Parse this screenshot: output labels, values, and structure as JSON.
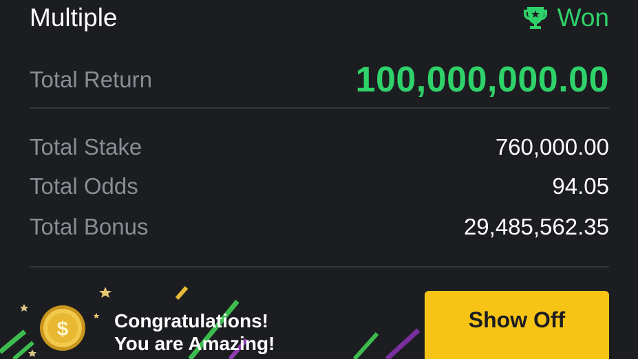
{
  "bet": {
    "type_label": "Multiple",
    "status_label": "Won",
    "status_icon": "trophy-icon",
    "total_return_label": "Total Return",
    "total_return_value": "100,000,000.00",
    "stats": [
      {
        "label": "Total Stake",
        "value": "760,000.00"
      },
      {
        "label": "Total Odds",
        "value": "94.05"
      },
      {
        "label": "Total Bonus",
        "value": "29,485,562.35"
      }
    ]
  },
  "banner": {
    "line1": "Congratulations!",
    "line2": "You are Amazing!",
    "button_label": "Show Off",
    "coin_icon": "coin-dollar-icon"
  },
  "colors": {
    "background": "#1c1d21",
    "accent_green": "#2fd26a",
    "label_gray": "#8a8d94",
    "button_yellow": "#f7c416"
  }
}
